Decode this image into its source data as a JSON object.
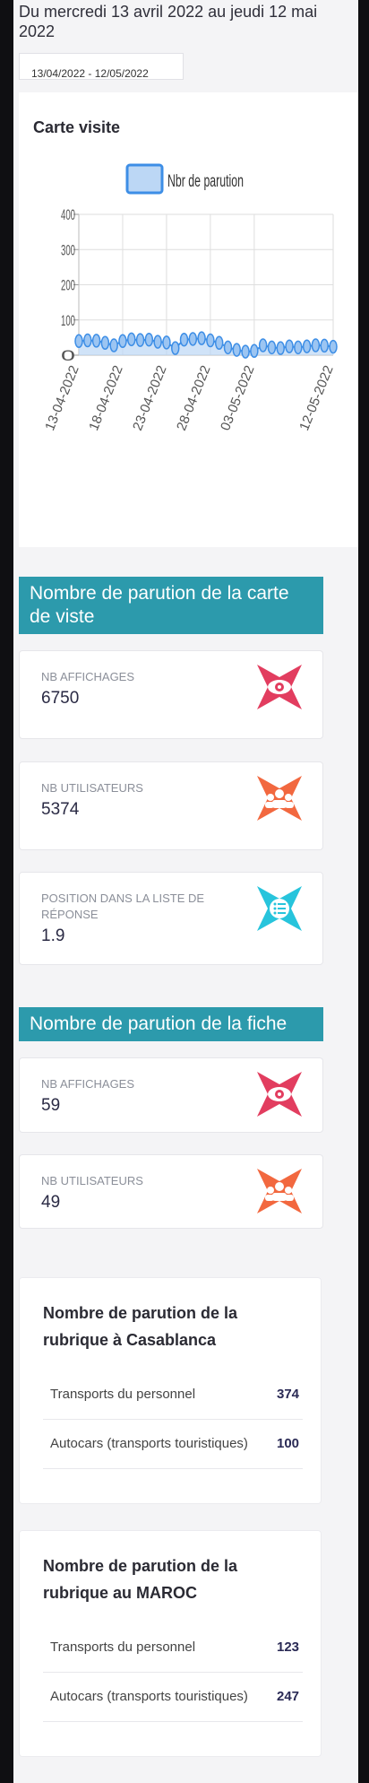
{
  "period_title": "Du mercredi 13 avril 2022 au jeudi 12 mai 2022",
  "date_range": "13/04/2022 - 12/05/2022",
  "chart_card": {
    "title": "Carte visite"
  },
  "colors": {
    "section_bg": "#2c9aac",
    "line": "#3d8ee6",
    "area": "#bcd7f5",
    "eye_icon": "#e23d5f",
    "users_icon": "#f2683f",
    "list_icon": "#27c4dc"
  },
  "chart_data": {
    "type": "area",
    "title": "",
    "xlabel": "",
    "ylabel": "",
    "ylim": [
      0,
      400
    ],
    "yticks": [
      "400",
      "300",
      "200",
      "100",
      "0"
    ],
    "xtick_labels": [
      "13-04-2022",
      "18-04-2022",
      "23-04-2022",
      "28-04-2022",
      "03-05-2022",
      "12-05-2022"
    ],
    "legend_position": "top",
    "grid": true,
    "series": [
      {
        "name": "Nbr de parution",
        "x": [
          "13-04-2022",
          "14-04-2022",
          "15-04-2022",
          "16-04-2022",
          "17-04-2022",
          "18-04-2022",
          "19-04-2022",
          "20-04-2022",
          "21-04-2022",
          "22-04-2022",
          "23-04-2022",
          "24-04-2022",
          "25-04-2022",
          "26-04-2022",
          "27-04-2022",
          "28-04-2022",
          "29-04-2022",
          "30-04-2022",
          "01-05-2022",
          "02-05-2022",
          "03-05-2022",
          "04-05-2022",
          "05-05-2022",
          "06-05-2022",
          "07-05-2022",
          "08-05-2022",
          "09-05-2022",
          "10-05-2022",
          "11-05-2022",
          "12-05-2022"
        ],
        "values": [
          40,
          42,
          41,
          35,
          28,
          40,
          45,
          43,
          44,
          38,
          36,
          20,
          44,
          46,
          48,
          42,
          35,
          22,
          15,
          10,
          12,
          28,
          22,
          20,
          25,
          22,
          25,
          28,
          27,
          24
        ]
      }
    ]
  },
  "section1": {
    "title": "Nombre de parution de la carte de viste",
    "cards": [
      {
        "label": "NB AFFICHAGES",
        "value": "6750",
        "icon": "eye-icon"
      },
      {
        "label": "NB UTILISATEURS",
        "value": "5374",
        "icon": "users-icon"
      },
      {
        "label": "POSITION DANS LA LISTE DE RÉPONSE",
        "value": "1.9",
        "icon": "list-icon"
      }
    ]
  },
  "section2": {
    "title": "Nombre de parution de la fiche",
    "cards": [
      {
        "label": "NB AFFICHAGES",
        "value": "59",
        "icon": "eye-icon"
      },
      {
        "label": "NB UTILISATEURS",
        "value": "49",
        "icon": "users-icon"
      }
    ]
  },
  "rubrique_casa": {
    "title": "Nombre de parution de la rubrique à Casablanca",
    "rows": [
      {
        "name": "Transports du personnel",
        "value": "374"
      },
      {
        "name": "Autocars (transports touristiques)",
        "value": "100"
      }
    ]
  },
  "rubrique_maroc": {
    "title": "Nombre de parution de la rubrique au MAROC",
    "rows": [
      {
        "name": "Transports du personnel",
        "value": "123"
      },
      {
        "name": "Autocars (transports touristiques)",
        "value": "247"
      }
    ]
  }
}
